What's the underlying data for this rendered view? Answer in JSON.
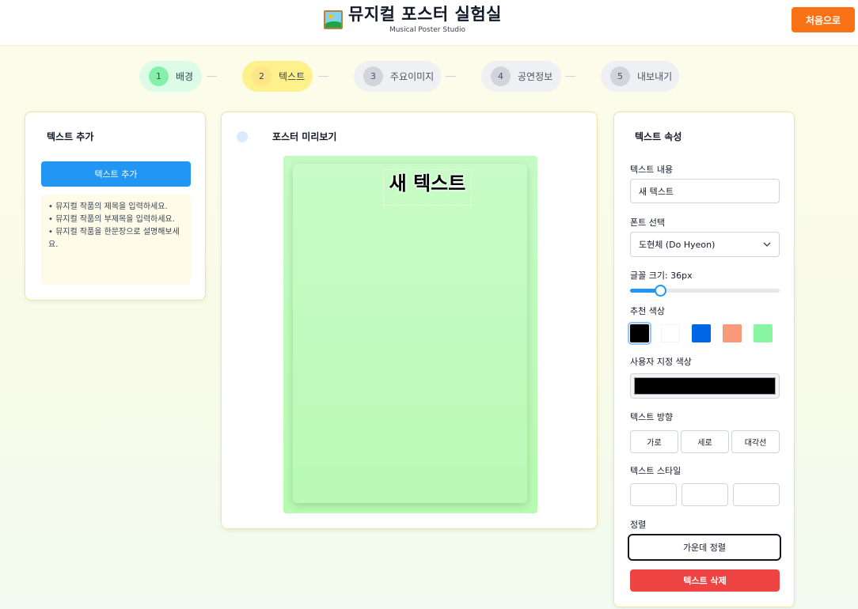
{
  "header": {
    "title": "뮤지컬 포스터 실험실",
    "subtitle": "Musical Poster Studio",
    "home_label": "처음으로"
  },
  "steps": [
    {
      "num": "1",
      "label": "배경",
      "state": "done"
    },
    {
      "num": "2",
      "label": "텍스트",
      "state": "active"
    },
    {
      "num": "3",
      "label": "주요이미지",
      "state": "pending"
    },
    {
      "num": "4",
      "label": "공연정보",
      "state": "pending"
    },
    {
      "num": "5",
      "label": "내보내기",
      "state": "pending"
    }
  ],
  "left_panel": {
    "title": "텍스트 추가",
    "add_button": "텍스트 추가",
    "tips": [
      "• 뮤지컬 작품의 제목을 입력하세요.",
      "• 뮤지컬 작품의 부제목을 입력하세요.",
      "• 뮤지컬 작품을 한문장으로 설명해보세요."
    ]
  },
  "preview": {
    "title": "포스터 미리보기",
    "poster_text": "새 텍스트"
  },
  "properties": {
    "title": "텍스트 속성",
    "content_label": "텍스트 내용",
    "content_value": "새 텍스트",
    "font_label": "폰트 선택",
    "font_value": "도현체 (Do Hyeon)",
    "size_label": "글꼴 크기: 36px",
    "size_level": 0.2,
    "recommended_label": "추천 색상",
    "swatches": [
      "#000000",
      "#ffffff",
      "#0066e6",
      "#f99a7c",
      "#88f5a2"
    ],
    "selected_swatch": "#000000",
    "custom_label": "사용자 지정 색상",
    "custom_color": "#000000",
    "direction_label": "텍스트 방향",
    "directions": [
      "가로",
      "세로",
      "대각선"
    ],
    "style_label": "텍스트 스타일",
    "align_label": "정렬",
    "align_button": "가운데 정렬",
    "delete_button": "텍스트 삭제"
  }
}
